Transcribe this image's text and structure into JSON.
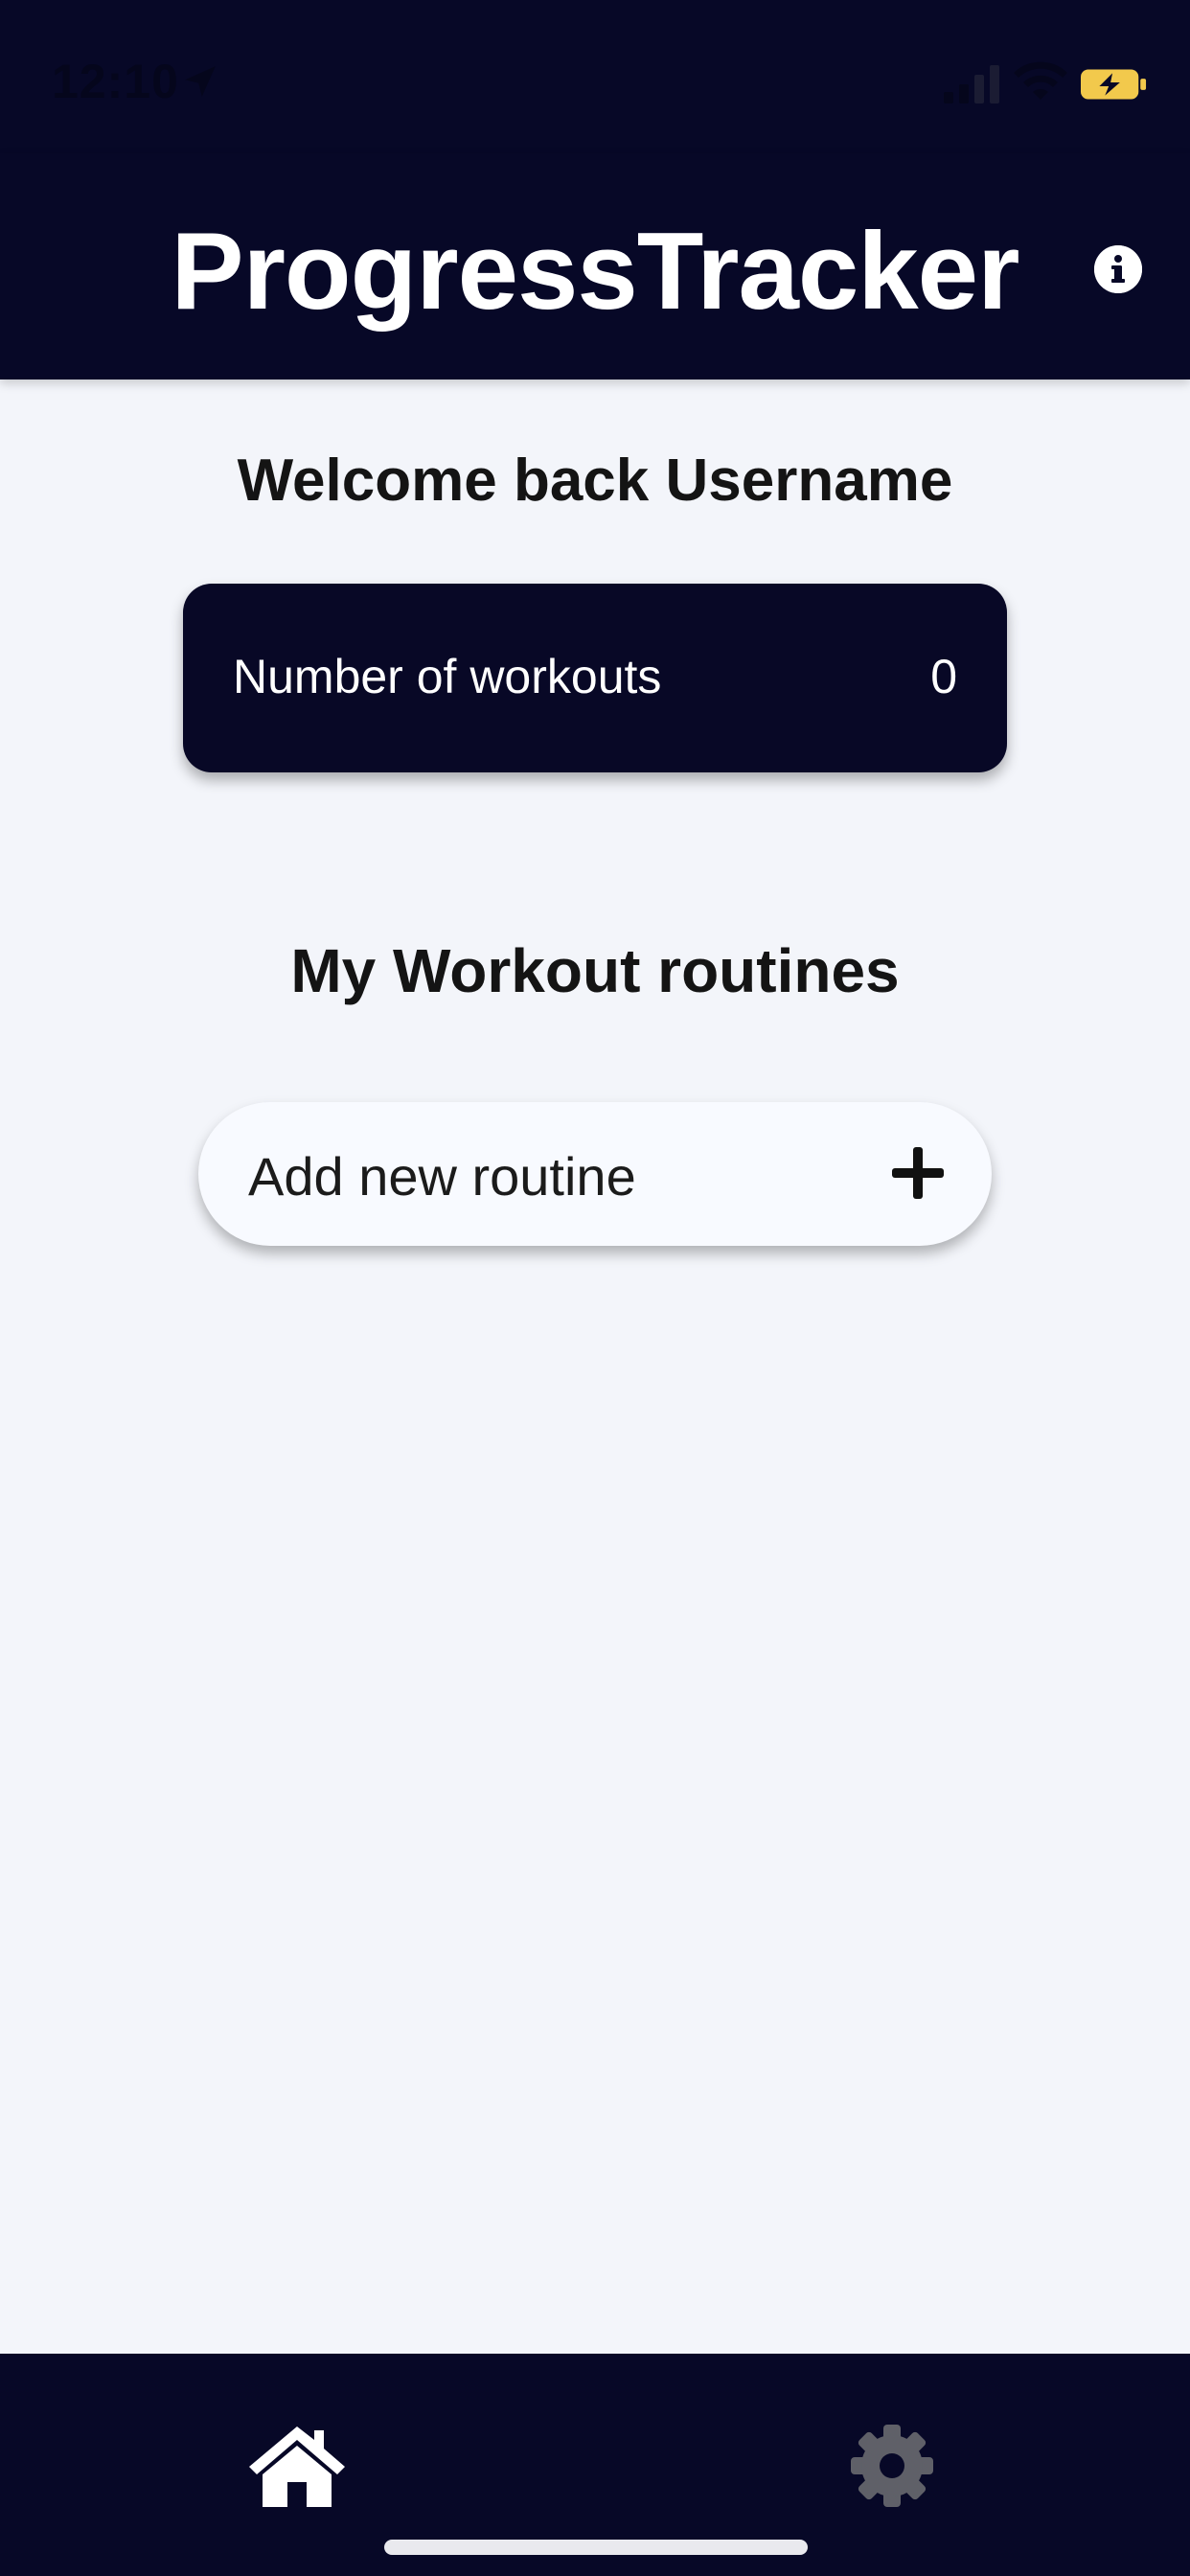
{
  "status_bar": {
    "time": "12:10",
    "icons": [
      "location-arrow-icon",
      "cellular-signal-icon",
      "wifi-icon",
      "battery-charging-icon"
    ],
    "battery_color": "#f2c94c"
  },
  "app_bar": {
    "title": "ProgressTracker",
    "info_icon": "info-circle-icon",
    "background": "#070827"
  },
  "welcome": {
    "text": "Welcome back Username"
  },
  "stats_card": {
    "label": "Number of workouts",
    "value": "0"
  },
  "routines": {
    "title": "My Workout routines",
    "add_button_label": "Add new routine",
    "add_icon": "plus-icon"
  },
  "tab_bar": {
    "tabs": [
      {
        "icon": "home-icon",
        "active": true,
        "color": "#ffffff"
      },
      {
        "icon": "gear-icon",
        "active": false,
        "color": "#5f6068"
      }
    ]
  }
}
